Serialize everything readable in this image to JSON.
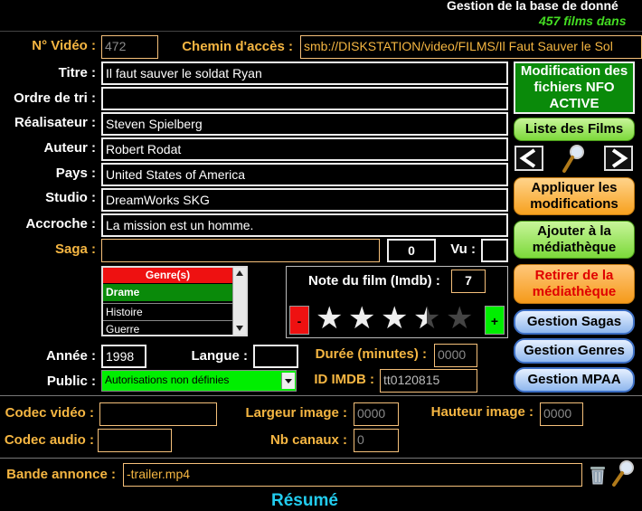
{
  "header": {
    "title": "Gestion de la base de donné",
    "subtitle": "457 films dans"
  },
  "labels": {
    "no_video": "N° Vidéo :",
    "chemin": "Chemin d'accès :",
    "titre": "Titre :",
    "ordre": "Ordre de tri :",
    "realisateur": "Réalisateur :",
    "auteur": "Auteur :",
    "pays": "Pays :",
    "studio": "Studio :",
    "accroche": "Accroche :",
    "saga": "Saga :",
    "vu": "Vu :",
    "note": "Note du film (Imdb) :",
    "annee": "Année :",
    "langue": "Langue :",
    "duree": "Durée (minutes) :",
    "public": "Public :",
    "id_imdb": "ID IMDB :",
    "codec_video": "Codec vidéo :",
    "largeur": "Largeur image :",
    "hauteur": "Hauteur image :",
    "codec_audio": "Codec audio :",
    "canaux": "Nb canaux :",
    "bande": "Bande annonce :",
    "resume": "Résumé"
  },
  "fields": {
    "no_video": "472",
    "chemin": "smb://DISKSTATION/video/FILMS/Il Faut Sauver le Sol",
    "titre": "Il faut sauver le soldat Ryan",
    "ordre": "",
    "realisateur": "Steven Spielberg",
    "auteur": "Robert Rodat",
    "pays": "United States of America",
    "studio": "DreamWorks SKG",
    "accroche": "La mission est un homme.",
    "saga": "",
    "saga_count": "0",
    "vu": "",
    "note": "7",
    "annee": "1998",
    "langue": "",
    "duree": "0000",
    "public": "Autorisations non définies",
    "id_imdb": "tt0120815",
    "codec_video": "",
    "largeur": "0000",
    "hauteur": "0000",
    "codec_audio": "",
    "canaux": "0",
    "bande": "-trailer.mp4"
  },
  "genres": {
    "header": "Genre(s)",
    "items": [
      "Drame",
      "Histoire",
      "Guerre"
    ],
    "selected": "Drame"
  },
  "rating": {
    "value": 3.5,
    "max": 5,
    "minus": "-",
    "plus": "+"
  },
  "buttons": {
    "modification_nfo": "Modification des fichiers NFO ACTIVE",
    "liste_films": "Liste des Films",
    "prev": "<",
    "next": ">",
    "appliquer": "Appliquer les modifications",
    "ajouter": "Ajouter à la médiathèque",
    "retirer": "Retirer de la médiathèque",
    "gestion_sagas": "Gestion Sagas",
    "gestion_genres": "Gestion Genres",
    "gestion_mpaa": "Gestion MPAA"
  },
  "colors": {
    "label_orange": "#f5b642",
    "nfo_green": "#0a8a0a",
    "public_green": "#00ee00",
    "genre_header_red": "#ee1111"
  }
}
